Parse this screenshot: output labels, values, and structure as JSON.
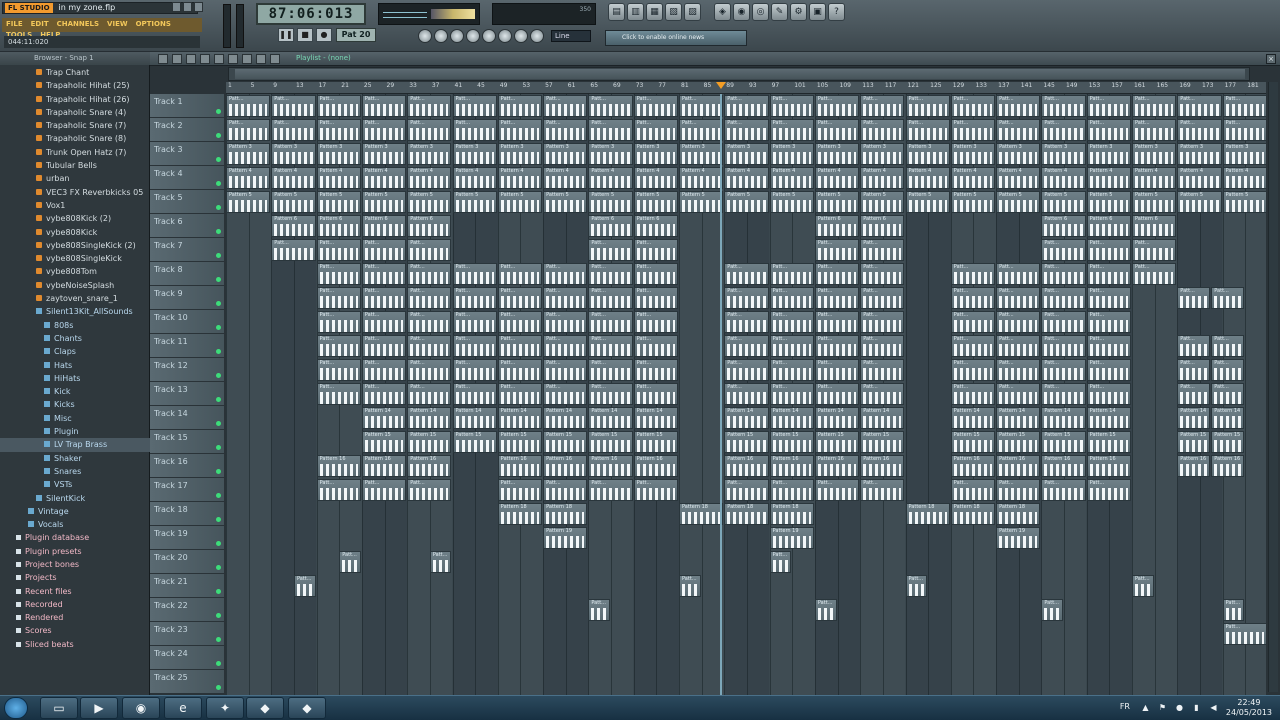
{
  "app": {
    "title": "in my zone.flp",
    "logo": "FL STUDIO",
    "menu": [
      "FILE",
      "EDIT",
      "CHANNELS",
      "VIEW",
      "OPTIONS",
      "TOOLS",
      "HELP"
    ],
    "hint": "044:11:020",
    "time_display": "87:06:013",
    "pattern_label": "Pat 20",
    "snap_label": "Line",
    "channel_hint": "Click to enable online news",
    "cpu_label": "350"
  },
  "browser": {
    "header": "Browser - Snap 1",
    "items": [
      {
        "label": "Trap Chant",
        "kind": "file"
      },
      {
        "label": "Trapaholic Hihat (25)",
        "kind": "file"
      },
      {
        "label": "Trapaholic Hihat (26)",
        "kind": "file"
      },
      {
        "label": "Trapaholic Snare (4)",
        "kind": "file"
      },
      {
        "label": "Trapaholic Snare (7)",
        "kind": "file"
      },
      {
        "label": "Trapaholic Snare (8)",
        "kind": "file"
      },
      {
        "label": "Trunk Open Hatz (7)",
        "kind": "file"
      },
      {
        "label": "Tubular Bells",
        "kind": "file"
      },
      {
        "label": "urban",
        "kind": "file"
      },
      {
        "label": "VEC3 FX Reverbkicks 05",
        "kind": "file"
      },
      {
        "label": "Vox1",
        "kind": "file"
      },
      {
        "label": "vybe808Kick (2)",
        "kind": "file"
      },
      {
        "label": "vybe808Kick",
        "kind": "file"
      },
      {
        "label": "vybe808SingleKick (2)",
        "kind": "file"
      },
      {
        "label": "vybe808SingleKick",
        "kind": "file"
      },
      {
        "label": "vybe808Tom",
        "kind": "file"
      },
      {
        "label": "vybeNoiseSplash",
        "kind": "file"
      },
      {
        "label": "zaytoven_snare_1",
        "kind": "file"
      },
      {
        "label": "Silent13Kit_AllSounds",
        "kind": "folder"
      },
      {
        "label": "808s",
        "kind": "folder"
      },
      {
        "label": "Chants",
        "kind": "folder"
      },
      {
        "label": "Claps",
        "kind": "folder"
      },
      {
        "label": "Hats",
        "kind": "folder"
      },
      {
        "label": "HiHats",
        "kind": "folder"
      },
      {
        "label": "Kick",
        "kind": "folder"
      },
      {
        "label": "Kicks",
        "kind": "folder"
      },
      {
        "label": "Misc",
        "kind": "folder"
      },
      {
        "label": "Plugin",
        "kind": "folder"
      },
      {
        "label": "LV Trap Brass",
        "kind": "folder",
        "selected": true
      },
      {
        "label": "Shaker",
        "kind": "folder"
      },
      {
        "label": "Snares",
        "kind": "folder"
      },
      {
        "label": "VSTs",
        "kind": "folder"
      },
      {
        "label": "SilentKick",
        "kind": "folder"
      },
      {
        "label": "Vintage",
        "kind": "folder"
      },
      {
        "label": "Vocals",
        "kind": "folder"
      },
      {
        "label": "Plugin database",
        "kind": "root"
      },
      {
        "label": "Plugin presets",
        "kind": "root"
      },
      {
        "label": "Project bones",
        "kind": "root"
      },
      {
        "label": "Projects",
        "kind": "root"
      },
      {
        "label": "Recent files",
        "kind": "root"
      },
      {
        "label": "Recorded",
        "kind": "root"
      },
      {
        "label": "Rendered",
        "kind": "root"
      },
      {
        "label": "Scores",
        "kind": "root"
      },
      {
        "label": "Sliced beats",
        "kind": "root"
      }
    ]
  },
  "playlist": {
    "title": "Playlist - (none)",
    "close_label": "×",
    "bars": [
      "1",
      "5",
      "9",
      "13",
      "17",
      "21",
      "25",
      "29",
      "33",
      "37",
      "41",
      "45",
      "49",
      "53",
      "57",
      "61",
      "65",
      "69",
      "73",
      "77",
      "81",
      "85",
      "89",
      "93",
      "97",
      "101",
      "105",
      "109",
      "113",
      "117",
      "121",
      "125",
      "129",
      "133",
      "137",
      "141",
      "145",
      "149",
      "153",
      "157",
      "161",
      "165",
      "169",
      "173",
      "177",
      "181"
    ],
    "tracks": [
      {
        "name": "Track 1",
        "pattern": "Patt..."
      },
      {
        "name": "Track 2",
        "pattern": "Patt..."
      },
      {
        "name": "Track 3",
        "pattern": "Pattern 3"
      },
      {
        "name": "Track 4",
        "pattern": "Pattern 4"
      },
      {
        "name": "Track 5",
        "pattern": "Pattern 5"
      },
      {
        "name": "Track 6",
        "pattern": "Pattern 6"
      },
      {
        "name": "Track 7",
        "pattern": "Patt..."
      },
      {
        "name": "Track 8",
        "pattern": "Patt..."
      },
      {
        "name": "Track 9",
        "pattern": "Patt..."
      },
      {
        "name": "Track 10",
        "pattern": "Patt..."
      },
      {
        "name": "Track 11",
        "pattern": "Patt..."
      },
      {
        "name": "Track 12",
        "pattern": "Patt..."
      },
      {
        "name": "Track 13",
        "pattern": "Patt..."
      },
      {
        "name": "Track 14",
        "pattern": "Pattern 14"
      },
      {
        "name": "Track 15",
        "pattern": "Pattern 15"
      },
      {
        "name": "Track 16",
        "pattern": "Pattern 16"
      },
      {
        "name": "Track 17",
        "pattern": "Patt..."
      },
      {
        "name": "Track 18",
        "pattern": "Pattern 18"
      },
      {
        "name": "Track 19",
        "pattern": "Pattern 19"
      },
      {
        "name": "Track 20",
        "pattern": "Patt..."
      },
      {
        "name": "Track 21",
        "pattern": "Patt..."
      },
      {
        "name": "Track 22",
        "pattern": "Patt..."
      },
      {
        "name": "Track 23",
        "pattern": "Patt..."
      },
      {
        "name": "Track 24",
        "pattern": ""
      },
      {
        "name": "Track 25",
        "pattern": ""
      }
    ]
  },
  "taskbar": {
    "lang": "FR",
    "time": "22:49",
    "date": "24/05/2013"
  }
}
